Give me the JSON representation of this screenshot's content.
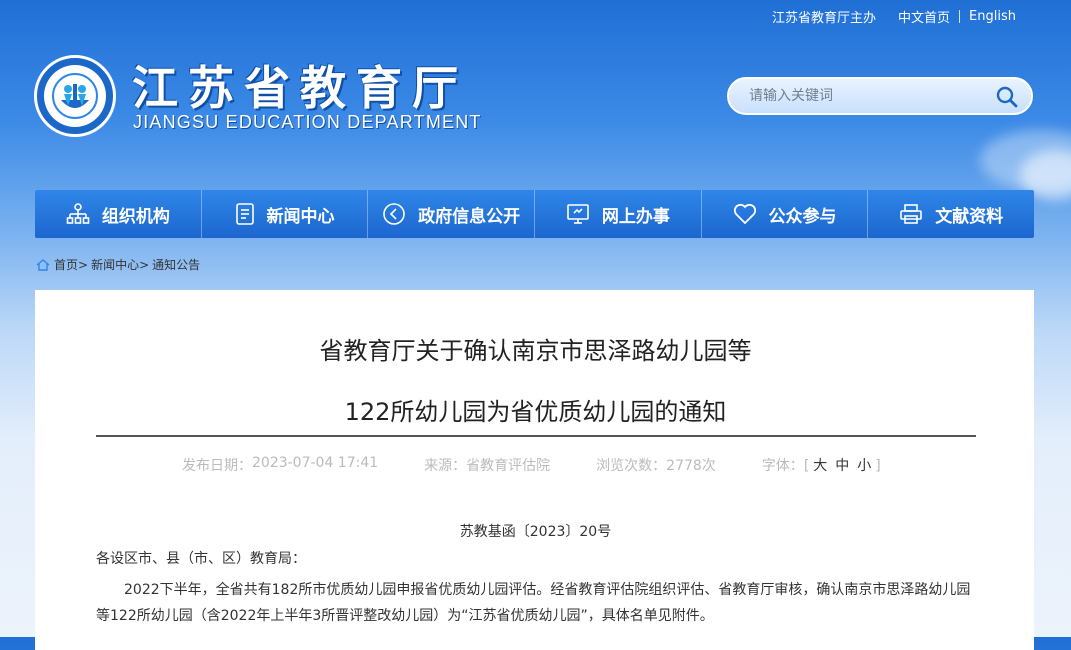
{
  "top_links": {
    "sponsor": "江苏省教育厅主办",
    "chinese": "中文首页",
    "english": "English"
  },
  "brand": {
    "name_cn": "江苏省教育厅",
    "name_en": "JIANGSU EDUCATION DEPARTMENT"
  },
  "search": {
    "placeholder": "请输入关键词"
  },
  "nav": [
    {
      "label": "组织机构",
      "icon": "org-chart-icon"
    },
    {
      "label": "新闻中心",
      "icon": "document-icon"
    },
    {
      "label": "政府信息公开",
      "icon": "open-info-icon"
    },
    {
      "label": "网上办事",
      "icon": "monitor-icon"
    },
    {
      "label": "公众参与",
      "icon": "heart-icon"
    },
    {
      "label": "文献资料",
      "icon": "printer-icon"
    }
  ],
  "breadcrumb": {
    "home": "首页",
    "sep1": ">",
    "section": "新闻中心",
    "sep2": ">",
    "current": "通知公告"
  },
  "article": {
    "title_line1": "省教育厅关于确认南京市思泽路幼儿园等",
    "title_line2": "122所幼儿园为省优质幼儿园的通知",
    "published_label": "发布日期：",
    "published": "2023-07-04 17:41",
    "source_label": "来源：",
    "source": "省教育评估院",
    "views_label": "浏览次数：",
    "views": "2778次",
    "font_label": "字体：",
    "font_open": "[",
    "font_large": "大",
    "font_medium": "中",
    "font_small": "小",
    "font_close": "]",
    "doc_number": "苏教基函〔2023〕20号",
    "salutation": "各设区市、县（市、区）教育局：",
    "body": "2022下半年，全省共有182所市优质幼儿园申报省优质幼儿园评估。经省教育评估院组织评估、省教育厅审核，确认南京市思泽路幼儿园等122所幼儿园（含2022年上半年3所晋评整改幼儿园）为“江苏省优质幼儿园”，具体名单见附件。"
  },
  "colors": {
    "nav": "#1f6fd6",
    "header_top": "#1f6fd6",
    "rule": "#555555"
  }
}
